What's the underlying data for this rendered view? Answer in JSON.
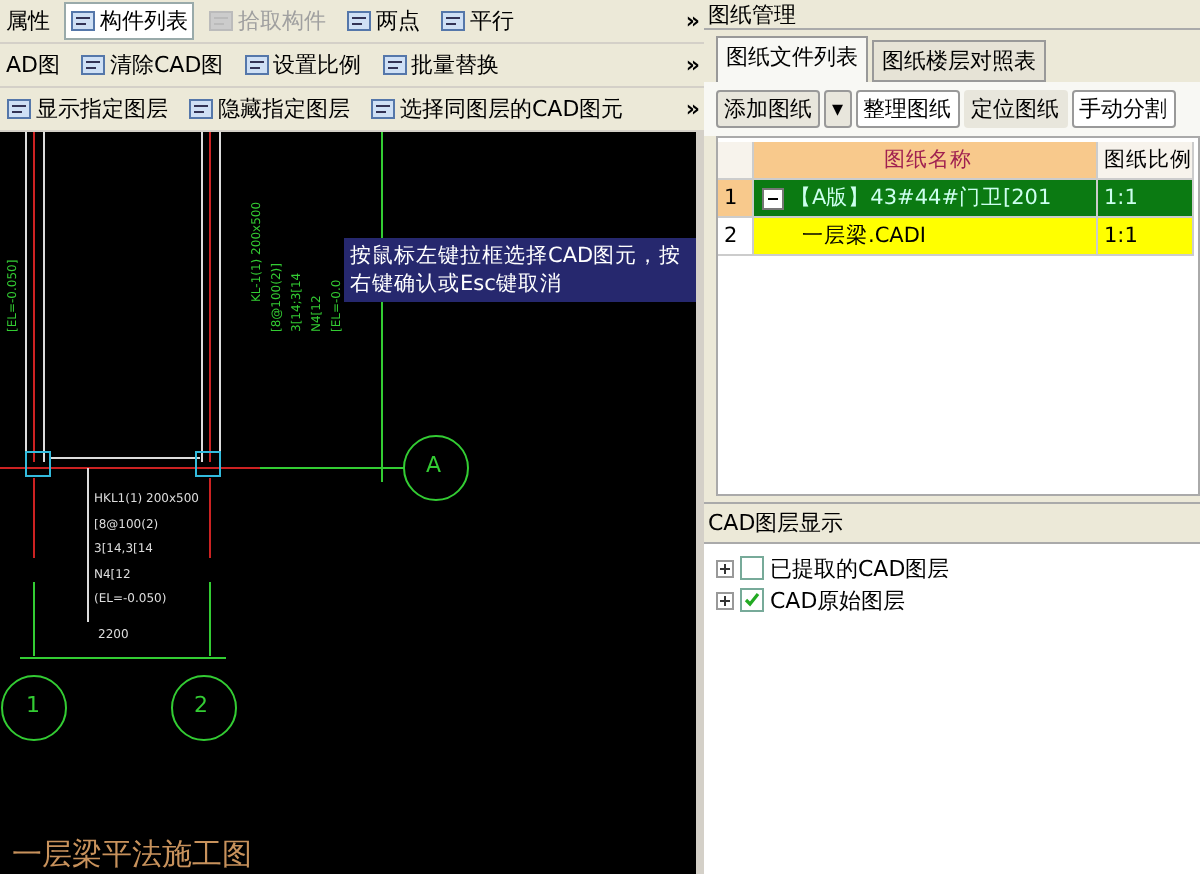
{
  "toolbar_rows": [
    {
      "items": [
        {
          "label": "属性",
          "disabled": false
        },
        {
          "label": "构件列表",
          "disabled": false
        },
        {
          "label": "拾取构件",
          "disabled": true
        },
        {
          "label": "两点",
          "disabled": false
        },
        {
          "label": "平行",
          "disabled": false
        }
      ],
      "more": "»"
    },
    {
      "items": [
        {
          "label": "AD图",
          "disabled": false
        },
        {
          "label": "清除CAD图",
          "disabled": false
        },
        {
          "label": "设置比例",
          "disabled": false
        },
        {
          "label": "批量替换",
          "disabled": false
        }
      ],
      "more": "»"
    },
    {
      "items": [
        {
          "label": "显示指定图层",
          "disabled": false
        },
        {
          "label": "隐藏指定图层",
          "disabled": false
        },
        {
          "label": "选择同图层的CAD图元",
          "disabled": false
        }
      ],
      "more": "»"
    }
  ],
  "canvas": {
    "tooltip": "按鼠标左键拉框选择CAD图元，按右键确认或Esc键取消",
    "vertical_labels": [
      {
        "text": "[EL=-0.050]"
      },
      {
        "text": "KL-1(1) 200x500"
      },
      {
        "text": "[8@100(2)]"
      },
      {
        "text": "3[14;3[14"
      },
      {
        "text": "N4[12"
      },
      {
        "text": "[EL=-0.0"
      }
    ],
    "beam_labels": [
      "HKL1(1) 200x500",
      "[8@100(2)",
      "3[14,3[14",
      "N4[12",
      "(EL=-0.050)"
    ],
    "dimension": "2200",
    "axes": [
      "A",
      "1",
      "2"
    ],
    "drawing_title": "一层梁平法施工图"
  },
  "panel": {
    "title": "图纸管理",
    "tabs": [
      {
        "label": "图纸文件列表",
        "selected": true
      },
      {
        "label": "图纸楼层对照表",
        "selected": false
      }
    ],
    "buttons": [
      {
        "label": "添加图纸",
        "kind": "split"
      },
      {
        "label": "整理图纸",
        "kind": "plain"
      },
      {
        "label": "定位图纸",
        "kind": "flat"
      },
      {
        "label": "手动分割",
        "kind": "plain"
      }
    ],
    "dropdown_arrow": "▾",
    "table": {
      "columns": [
        "图纸名称",
        "图纸比例"
      ],
      "rows": [
        {
          "index": "1",
          "name": "【A版】43#44#门卫[201",
          "scale": "1:1",
          "selected": true,
          "expanded": true,
          "children": [
            {
              "index": "2",
              "name": "一层梁.CADI",
              "scale": "1:1",
              "selected": false
            }
          ]
        }
      ]
    },
    "layers": {
      "title": "CAD图层显示",
      "items": [
        {
          "label": "已提取的CAD图层",
          "checked": false,
          "expanded": false
        },
        {
          "label": "CAD原始图层",
          "checked": true,
          "expanded": false
        }
      ]
    }
  }
}
